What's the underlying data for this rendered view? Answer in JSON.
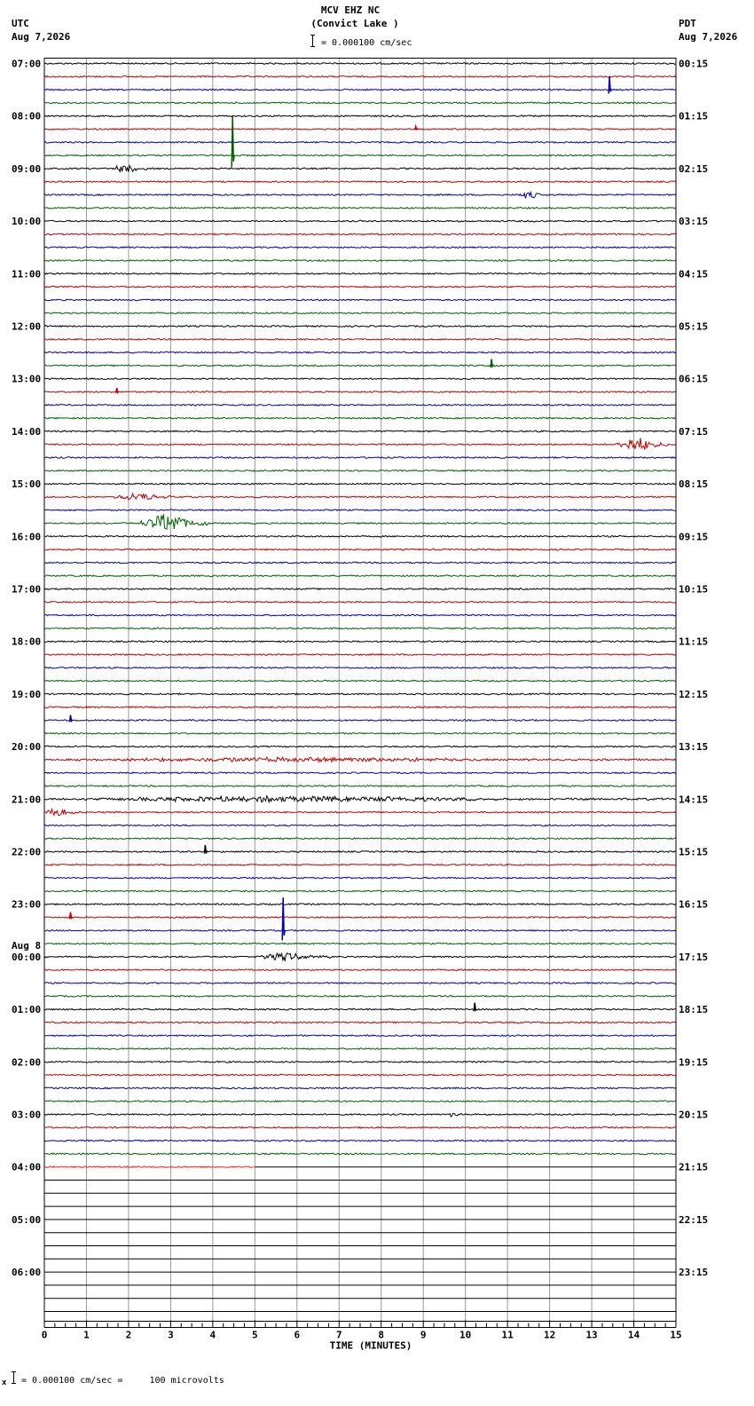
{
  "header": {
    "station": "MCV EHZ NC",
    "location": "(Convict Lake )",
    "left_tz": "UTC",
    "left_date": "Aug 7,2026",
    "right_tz": "PDT",
    "right_date": "Aug 7,2026",
    "scale_text": "= 0.000100 cm/sec"
  },
  "footer": {
    "scale_text": "= 0.000100 cm/sec =     100 microvolts"
  },
  "chart_data": {
    "type": "line",
    "xlabel": "TIME (MINUTES)",
    "x_ticks": [
      "0",
      "1",
      "2",
      "3",
      "4",
      "5",
      "6",
      "7",
      "8",
      "9",
      "10",
      "11",
      "12",
      "13",
      "14",
      "15"
    ],
    "xlim": [
      0,
      15
    ],
    "trace_colors": [
      "#000000",
      "#c00000",
      "#0000b0",
      "#006000"
    ],
    "active_trace_color": "#ff2020",
    "left_labels": [
      {
        "row": 0,
        "text": "07:00"
      },
      {
        "row": 4,
        "text": "08:00"
      },
      {
        "row": 8,
        "text": "09:00"
      },
      {
        "row": 12,
        "text": "10:00"
      },
      {
        "row": 16,
        "text": "11:00"
      },
      {
        "row": 20,
        "text": "12:00"
      },
      {
        "row": 24,
        "text": "13:00"
      },
      {
        "row": 28,
        "text": "14:00"
      },
      {
        "row": 32,
        "text": "15:00"
      },
      {
        "row": 36,
        "text": "16:00"
      },
      {
        "row": 40,
        "text": "17:00"
      },
      {
        "row": 44,
        "text": "18:00"
      },
      {
        "row": 48,
        "text": "19:00"
      },
      {
        "row": 52,
        "text": "20:00"
      },
      {
        "row": 56,
        "text": "21:00"
      },
      {
        "row": 60,
        "text": "22:00"
      },
      {
        "row": 64,
        "text": "23:00"
      },
      {
        "row": 68,
        "text": "00:00",
        "date": "Aug 8"
      },
      {
        "row": 72,
        "text": "01:00"
      },
      {
        "row": 76,
        "text": "02:00"
      },
      {
        "row": 80,
        "text": "03:00"
      },
      {
        "row": 84,
        "text": "04:00"
      },
      {
        "row": 88,
        "text": "05:00"
      },
      {
        "row": 92,
        "text": "06:00"
      }
    ],
    "right_labels": [
      {
        "row": 0,
        "text": "00:15"
      },
      {
        "row": 4,
        "text": "01:15"
      },
      {
        "row": 8,
        "text": "02:15"
      },
      {
        "row": 12,
        "text": "03:15"
      },
      {
        "row": 16,
        "text": "04:15"
      },
      {
        "row": 20,
        "text": "05:15"
      },
      {
        "row": 24,
        "text": "06:15"
      },
      {
        "row": 28,
        "text": "07:15"
      },
      {
        "row": 32,
        "text": "08:15"
      },
      {
        "row": 36,
        "text": "09:15"
      },
      {
        "row": 40,
        "text": "10:15"
      },
      {
        "row": 44,
        "text": "11:15"
      },
      {
        "row": 48,
        "text": "12:15"
      },
      {
        "row": 52,
        "text": "13:15"
      },
      {
        "row": 56,
        "text": "14:15"
      },
      {
        "row": 60,
        "text": "15:15"
      },
      {
        "row": 64,
        "text": "16:15"
      },
      {
        "row": 68,
        "text": "17:15"
      },
      {
        "row": 72,
        "text": "18:15"
      },
      {
        "row": 76,
        "text": "19:15"
      },
      {
        "row": 80,
        "text": "20:15"
      },
      {
        "row": 84,
        "text": "21:15"
      },
      {
        "row": 88,
        "text": "22:15"
      },
      {
        "row": 92,
        "text": "23:15"
      }
    ],
    "rows_total": 96,
    "rows_with_data": 85,
    "partial_row": {
      "row": 84,
      "end_minute": 5
    },
    "events": [
      {
        "row": 2,
        "minute": 13.4,
        "amplitude": 1.0,
        "kind": "spike"
      },
      {
        "row": 5,
        "minute": 8.8,
        "amplitude": 0.2,
        "kind": "spike"
      },
      {
        "row": 7,
        "minute": 4.45,
        "amplitude": 3.0,
        "kind": "spike"
      },
      {
        "row": 8,
        "minute": 1.6,
        "duration": 0.9,
        "amplitude": 0.3,
        "kind": "burst"
      },
      {
        "row": 10,
        "minute": 11.2,
        "duration": 0.8,
        "amplitude": 0.25,
        "kind": "burst"
      },
      {
        "row": 23,
        "minute": 10.6,
        "amplitude": 0.5,
        "kind": "spike"
      },
      {
        "row": 25,
        "minute": 1.7,
        "amplitude": 0.3,
        "kind": "spike"
      },
      {
        "row": 29,
        "minute": 13.6,
        "duration": 1.2,
        "amplitude": 0.6,
        "kind": "burst"
      },
      {
        "row": 33,
        "minute": 1.6,
        "duration": 1.6,
        "amplitude": 0.3,
        "kind": "burst"
      },
      {
        "row": 35,
        "minute": 2.3,
        "duration": 1.6,
        "amplitude": 0.7,
        "kind": "burst"
      },
      {
        "row": 50,
        "minute": 0.6,
        "amplitude": 0.4,
        "kind": "spike"
      },
      {
        "row": 53,
        "minute": 0.3,
        "duration": 14.6,
        "amplitude": 0.15,
        "kind": "burst"
      },
      {
        "row": 56,
        "minute": 0.3,
        "duration": 14.6,
        "amplitude": 0.2,
        "kind": "burst"
      },
      {
        "row": 57,
        "minute": 0.0,
        "duration": 0.8,
        "amplitude": 0.3,
        "kind": "burst"
      },
      {
        "row": 60,
        "minute": 3.8,
        "amplitude": 0.5,
        "kind": "spike"
      },
      {
        "row": 66,
        "minute": 5.65,
        "amplitude": 2.5,
        "kind": "spike"
      },
      {
        "row": 65,
        "minute": 0.6,
        "amplitude": 0.4,
        "kind": "spike"
      },
      {
        "row": 68,
        "minute": 5.0,
        "duration": 1.8,
        "amplitude": 0.3,
        "kind": "burst"
      },
      {
        "row": 72,
        "minute": 10.2,
        "amplitude": 0.5,
        "kind": "spike"
      },
      {
        "row": 80,
        "minute": 9.6,
        "duration": 0.3,
        "amplitude": 0.3,
        "kind": "burst"
      }
    ]
  }
}
